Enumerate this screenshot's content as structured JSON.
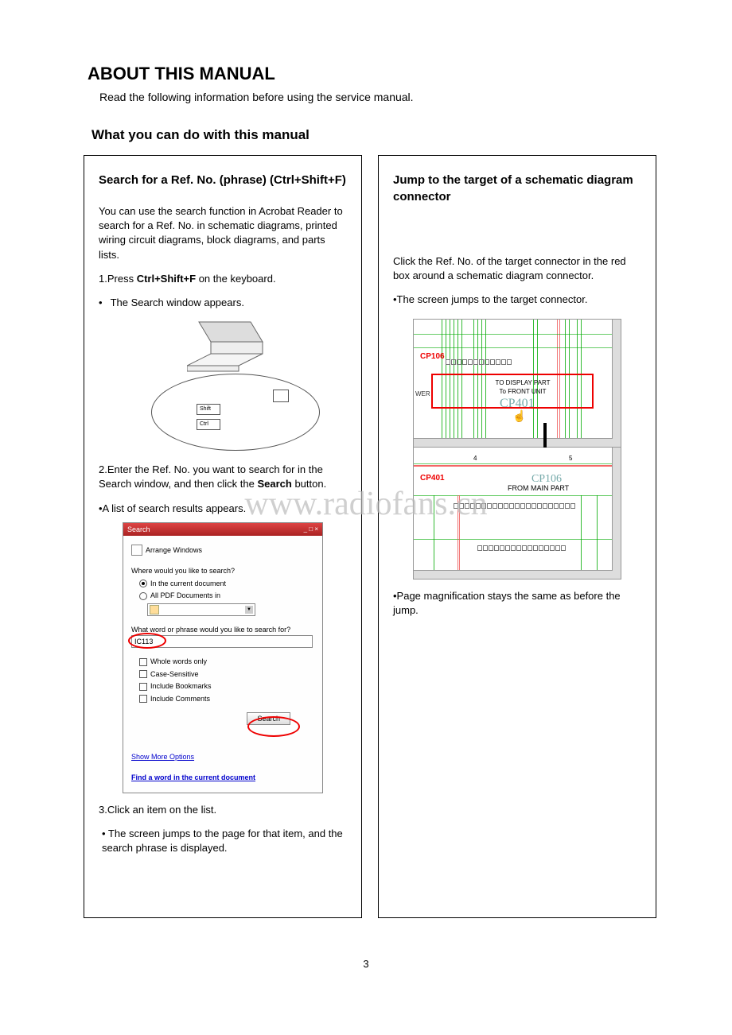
{
  "title": "ABOUT THIS MANUAL",
  "intro": "Read the following information before using the service manual.",
  "section_heading": "What you can do with this manual",
  "watermark": "www.radiofans.cn",
  "page_number": "3",
  "left": {
    "title": "Search for a Ref. No. (phrase) (Ctrl+Shift+F)",
    "p1": "You can use the search function in Acrobat Reader to search for a Ref. No. in schematic diagrams, printed wiring circuit diagrams, block diagrams, and parts lists.",
    "step1_prefix": "1.Press ",
    "step1_bold": "Ctrl+Shift+F",
    "step1_suffix": " on the keyboard.",
    "step1_bullet": "The Search window appears.",
    "key_shift": "Shift",
    "key_ctrl": "Ctrl",
    "step2_prefix": "2.Enter the Ref. No. you want to search for in the Search window, and then click the ",
    "step2_bold": "Search",
    "step2_suffix": " button.",
    "step2_bullet": "•A list of search results appears.",
    "dialog": {
      "title": "Search",
      "arrange": "Arrange Windows",
      "q1": "Where would you like to search?",
      "opt1": "In the current document",
      "opt2": "All PDF Documents in",
      "q2": "What word or phrase would you like to search for?",
      "input_value": "IC113",
      "chk1": "Whole words only",
      "chk2": "Case-Sensitive",
      "chk3": "Include Bookmarks",
      "chk4": "Include Comments",
      "btn": "Search",
      "link1": "Show More Options",
      "link2": "Find a word in the current document"
    },
    "step3": "3.Click an item on the list.",
    "step3_bullet": "• The screen jumps to the page for that item, and the search phrase is displayed."
  },
  "right": {
    "title": "Jump to the target of a schematic diagram connector",
    "p1": "Click the Ref. No. of the target connector in the red box around a schematic diagram connector.",
    "p1_bullet": "•The screen jumps to the target connector.",
    "schematic": {
      "cp106": "CP106",
      "wer": "WER",
      "display_line1": "TO DISPLAY PART",
      "display_line2": "To FRONT UNIT",
      "cp401": "CP401",
      "axis4": "4",
      "axis5": "5",
      "cp106b": "CP106",
      "from_main": "FROM MAIN PART"
    },
    "footer": "•Page magnification stays the same as before the jump."
  }
}
